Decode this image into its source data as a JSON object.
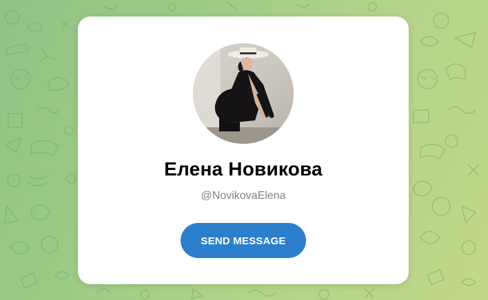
{
  "background": {
    "pattern": "doodle-pattern",
    "colors": [
      "#8fc285",
      "#b4d48a",
      "#c3d888"
    ]
  },
  "profile": {
    "name": "Елена Новикова",
    "username": "@NovikovaElena",
    "avatar": "profile-photo"
  },
  "actions": {
    "send_message_label": "SEND MESSAGE",
    "accent_color": "#2b7fcd"
  }
}
